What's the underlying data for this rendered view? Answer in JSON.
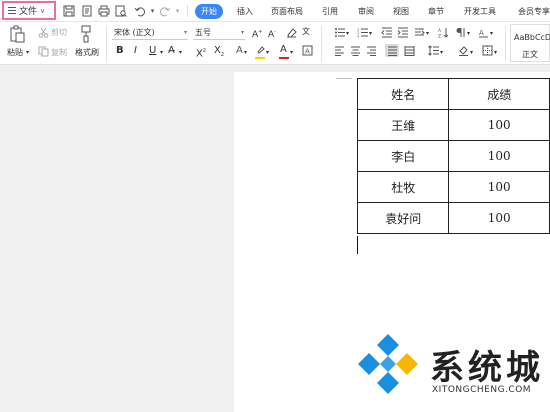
{
  "menubar": {
    "file_label": "文件",
    "tabs": [
      {
        "label": "开始",
        "active": true
      },
      {
        "label": "插入",
        "active": false
      },
      {
        "label": "页面布局",
        "active": false
      },
      {
        "label": "引用",
        "active": false
      },
      {
        "label": "审阅",
        "active": false
      },
      {
        "label": "视图",
        "active": false
      },
      {
        "label": "章节",
        "active": false
      },
      {
        "label": "开发工具",
        "active": false
      },
      {
        "label": "会员专享",
        "active": false
      }
    ]
  },
  "ribbon": {
    "paste_label": "粘贴",
    "cut_label": "剪切",
    "copy_label": "复制",
    "format_painter_label": "格式刷",
    "font_name": "宋体 (正文)",
    "font_size": "五号",
    "style_sample": "AaBbCcDd",
    "style_name": "正文"
  },
  "table": {
    "headers": [
      "姓名",
      "成绩"
    ],
    "rows": [
      [
        "王维",
        "100"
      ],
      [
        "李白",
        "100"
      ],
      [
        "杜牧",
        "100"
      ],
      [
        "袁好问",
        "100"
      ]
    ]
  },
  "watermark": {
    "title": "系统城",
    "subtitle": "XITONGCHENG.COM"
  },
  "colors": {
    "accent": "#3b86f7",
    "file_highlight": "#f06c9b",
    "logo_blue": "#1a8fe0"
  }
}
